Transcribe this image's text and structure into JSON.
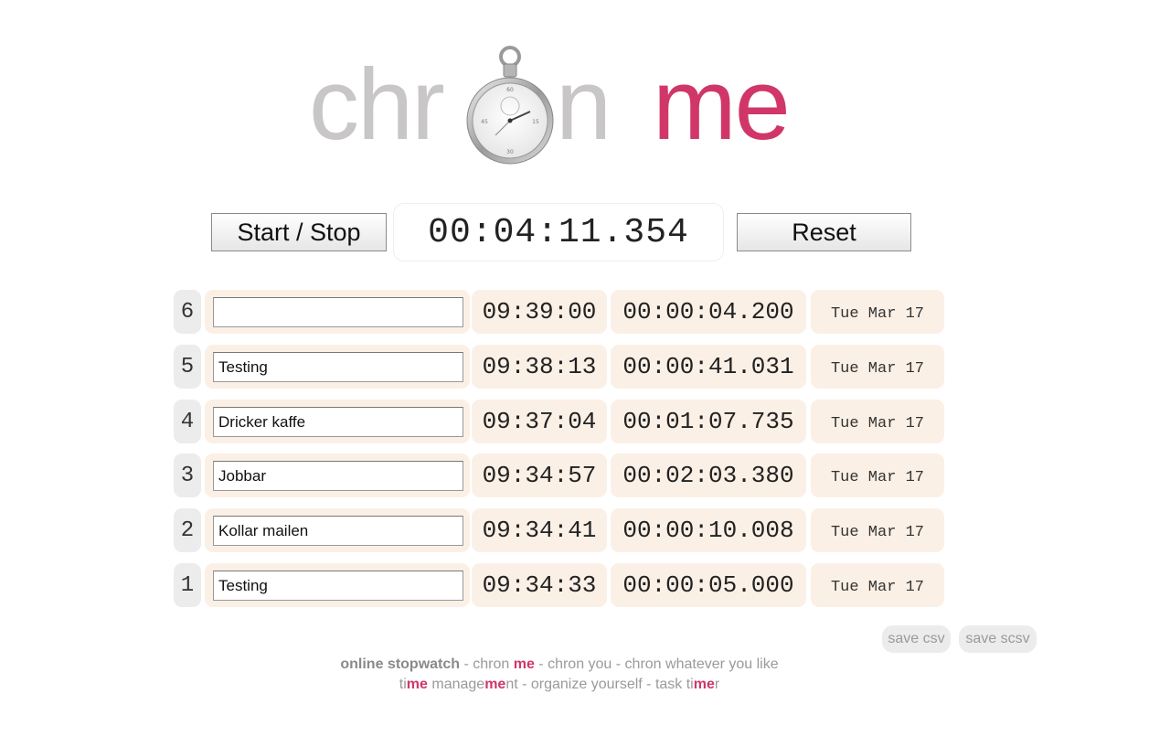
{
  "logo": {
    "part1": "chr",
    "part2": "n",
    "part3": "me"
  },
  "controls": {
    "start_stop": "Start / Stop",
    "timer": "00:04:11.354",
    "reset": "Reset"
  },
  "rows": [
    {
      "num": "6",
      "name": "",
      "start": "09:39:00",
      "duration": "00:00:04.200",
      "date": "Tue Mar 17"
    },
    {
      "num": "5",
      "name": "Testing",
      "start": "09:38:13",
      "duration": "00:00:41.031",
      "date": "Tue Mar 17"
    },
    {
      "num": "4",
      "name": "Dricker kaffe",
      "start": "09:37:04",
      "duration": "00:01:07.735",
      "date": "Tue Mar 17"
    },
    {
      "num": "3",
      "name": "Jobbar",
      "start": "09:34:57",
      "duration": "00:02:03.380",
      "date": "Tue Mar 17"
    },
    {
      "num": "2",
      "name": "Kollar mailen",
      "start": "09:34:41",
      "duration": "00:00:10.008",
      "date": "Tue Mar 17"
    },
    {
      "num": "1",
      "name": "Testing",
      "start": "09:34:33",
      "duration": "00:00:05.000",
      "date": "Tue Mar 17"
    }
  ],
  "save": {
    "csv": "save csv",
    "scsv": "save scsv"
  },
  "footer": {
    "line1": {
      "a": "online stopwatch",
      "b": " - chron ",
      "c": "me",
      "d": " - chron you - chron whatever you like"
    },
    "line2": {
      "a": "ti",
      "b": "me",
      "c": " manage",
      "d": "me",
      "e": "nt - organize yourself - task ti",
      "f": "me",
      "g": "r"
    }
  },
  "colors": {
    "brand_pink": "#d03768",
    "logo_grey": "#c9c6c7",
    "cell_bg": "#fbf0e6",
    "num_bg": "#ececec"
  }
}
